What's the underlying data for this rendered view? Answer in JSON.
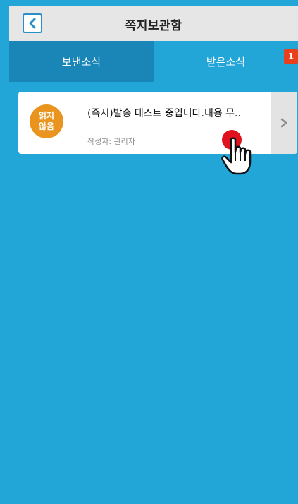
{
  "header": {
    "title": "쪽지보관함",
    "back_icon": "chevron-left-icon"
  },
  "tabs": [
    {
      "label": "보낸소식",
      "active": false
    },
    {
      "label": "받은소식",
      "active": true,
      "badge": "1"
    }
  ],
  "messages": [
    {
      "status_line1": "읽지",
      "status_line2": "않음",
      "title": "(즉시)발송 테스트 중입니다.내용 무..",
      "author": "작성자: 관리자",
      "arrow_icon": "chevron-right-icon"
    }
  ],
  "colors": {
    "background": "#21a6d7",
    "tab_sent": "#1a86b7",
    "badge": "#e8401d",
    "unread": "#e9941e",
    "tap_indicator": "#e0121e"
  }
}
